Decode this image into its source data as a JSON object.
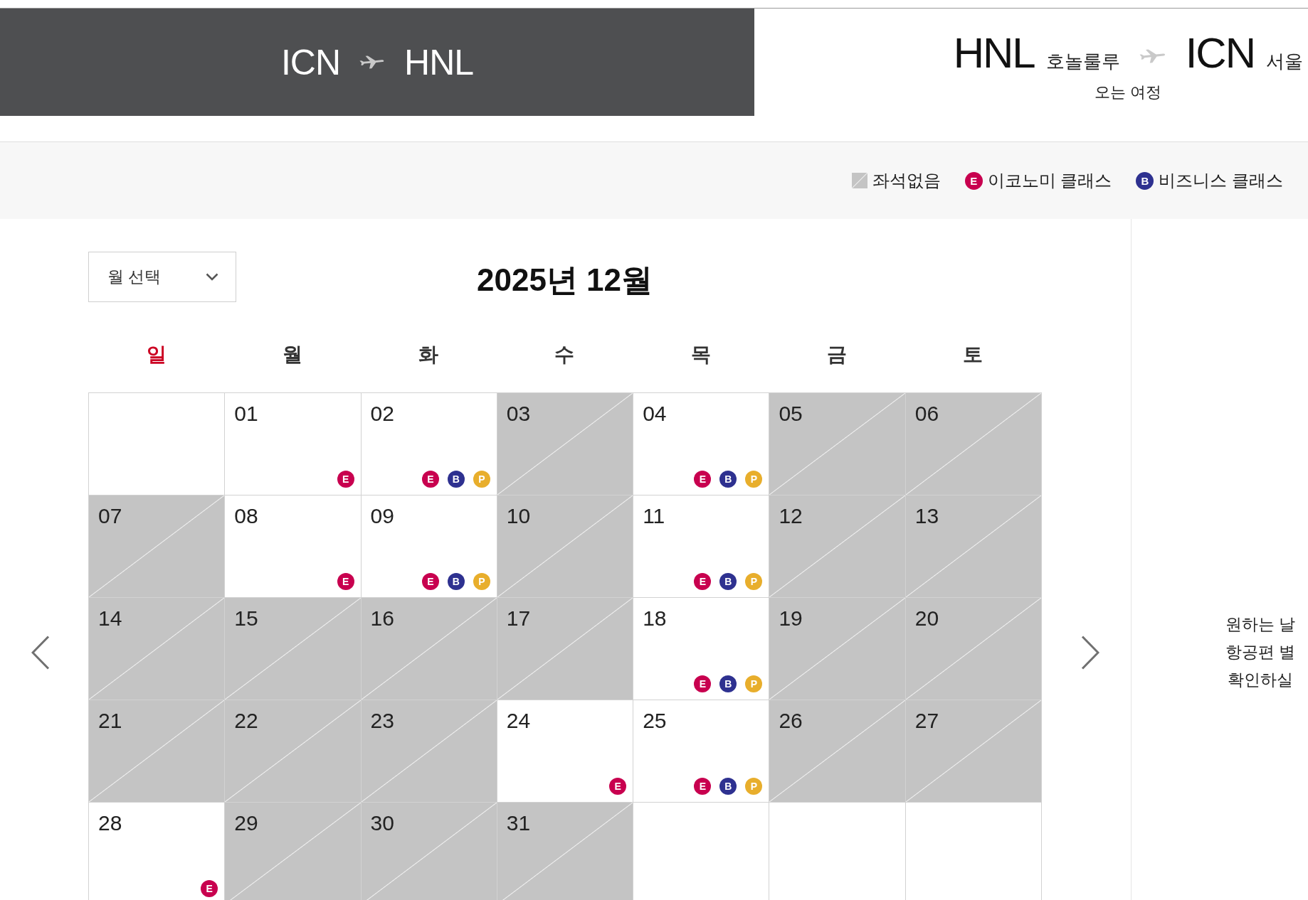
{
  "tabs": [
    {
      "origin": "ICN",
      "destination": "HNL",
      "selected": false
    },
    {
      "origin": "HNL",
      "origin_city": "호놀룰루",
      "destination": "ICN",
      "destination_city": "서울",
      "subtitle": "오는 여정",
      "selected": true
    }
  ],
  "legend": [
    {
      "kind": "swatch",
      "label": "좌석없음"
    },
    {
      "kind": "badge",
      "letter": "E",
      "color": "#c8004f",
      "label": "이코노미 클래스"
    },
    {
      "kind": "badge",
      "letter": "B",
      "color": "#2e3190",
      "label": "비즈니스 클래스"
    }
  ],
  "calendar": {
    "month_select": {
      "label": "월 선택"
    },
    "title": "2025년 12월",
    "weekdays": [
      {
        "label": "일",
        "color": "#cc0022"
      },
      {
        "label": "월",
        "color": "#333333"
      },
      {
        "label": "화",
        "color": "#333333"
      },
      {
        "label": "수",
        "color": "#333333"
      },
      {
        "label": "목",
        "color": "#333333"
      },
      {
        "label": "금",
        "color": "#333333"
      },
      {
        "label": "토",
        "color": "#333333"
      }
    ],
    "weeks": [
      [
        {
          "kind": "blank"
        },
        {
          "kind": "day",
          "day": "01",
          "available": true,
          "classes": [
            {
              "letter": "E",
              "color": "#c8004f"
            }
          ]
        },
        {
          "kind": "day",
          "day": "02",
          "available": true,
          "classes": [
            {
              "letter": "E",
              "color": "#c8004f"
            },
            {
              "letter": "B",
              "color": "#2e3190"
            },
            {
              "letter": "P",
              "color": "#e8ae2c"
            }
          ]
        },
        {
          "kind": "day",
          "day": "03",
          "available": false
        },
        {
          "kind": "day",
          "day": "04",
          "available": true,
          "classes": [
            {
              "letter": "E",
              "color": "#c8004f"
            },
            {
              "letter": "B",
              "color": "#2e3190"
            },
            {
              "letter": "P",
              "color": "#e8ae2c"
            }
          ]
        },
        {
          "kind": "day",
          "day": "05",
          "available": false
        },
        {
          "kind": "day",
          "day": "06",
          "available": false
        }
      ],
      [
        {
          "kind": "day",
          "day": "07",
          "available": false
        },
        {
          "kind": "day",
          "day": "08",
          "available": true,
          "classes": [
            {
              "letter": "E",
              "color": "#c8004f"
            }
          ]
        },
        {
          "kind": "day",
          "day": "09",
          "available": true,
          "classes": [
            {
              "letter": "E",
              "color": "#c8004f"
            },
            {
              "letter": "B",
              "color": "#2e3190"
            },
            {
              "letter": "P",
              "color": "#e8ae2c"
            }
          ]
        },
        {
          "kind": "day",
          "day": "10",
          "available": false
        },
        {
          "kind": "day",
          "day": "11",
          "available": true,
          "classes": [
            {
              "letter": "E",
              "color": "#c8004f"
            },
            {
              "letter": "B",
              "color": "#2e3190"
            },
            {
              "letter": "P",
              "color": "#e8ae2c"
            }
          ]
        },
        {
          "kind": "day",
          "day": "12",
          "available": false
        },
        {
          "kind": "day",
          "day": "13",
          "available": false
        }
      ],
      [
        {
          "kind": "day",
          "day": "14",
          "available": false
        },
        {
          "kind": "day",
          "day": "15",
          "available": false
        },
        {
          "kind": "day",
          "day": "16",
          "available": false
        },
        {
          "kind": "day",
          "day": "17",
          "available": false
        },
        {
          "kind": "day",
          "day": "18",
          "available": true,
          "classes": [
            {
              "letter": "E",
              "color": "#c8004f"
            },
            {
              "letter": "B",
              "color": "#2e3190"
            },
            {
              "letter": "P",
              "color": "#e8ae2c"
            }
          ]
        },
        {
          "kind": "day",
          "day": "19",
          "available": false
        },
        {
          "kind": "day",
          "day": "20",
          "available": false
        }
      ],
      [
        {
          "kind": "day",
          "day": "21",
          "available": false
        },
        {
          "kind": "day",
          "day": "22",
          "available": false
        },
        {
          "kind": "day",
          "day": "23",
          "available": false
        },
        {
          "kind": "day",
          "day": "24",
          "available": true,
          "classes": [
            {
              "letter": "E",
              "color": "#c8004f"
            }
          ]
        },
        {
          "kind": "day",
          "day": "25",
          "available": true,
          "classes": [
            {
              "letter": "E",
              "color": "#c8004f"
            },
            {
              "letter": "B",
              "color": "#2e3190"
            },
            {
              "letter": "P",
              "color": "#e8ae2c"
            }
          ]
        },
        {
          "kind": "day",
          "day": "26",
          "available": false
        },
        {
          "kind": "day",
          "day": "27",
          "available": false
        }
      ],
      [
        {
          "kind": "day",
          "day": "28",
          "available": true,
          "classes": [
            {
              "letter": "E",
              "color": "#c8004f"
            }
          ]
        },
        {
          "kind": "day",
          "day": "29",
          "available": false
        },
        {
          "kind": "day",
          "day": "30",
          "available": false
        },
        {
          "kind": "day",
          "day": "31",
          "available": false
        },
        {
          "kind": "blank"
        },
        {
          "kind": "blank"
        },
        {
          "kind": "blank"
        }
      ]
    ]
  },
  "side_note": {
    "lines": [
      "원하는 날",
      "항공편 별",
      "확인하실"
    ]
  }
}
